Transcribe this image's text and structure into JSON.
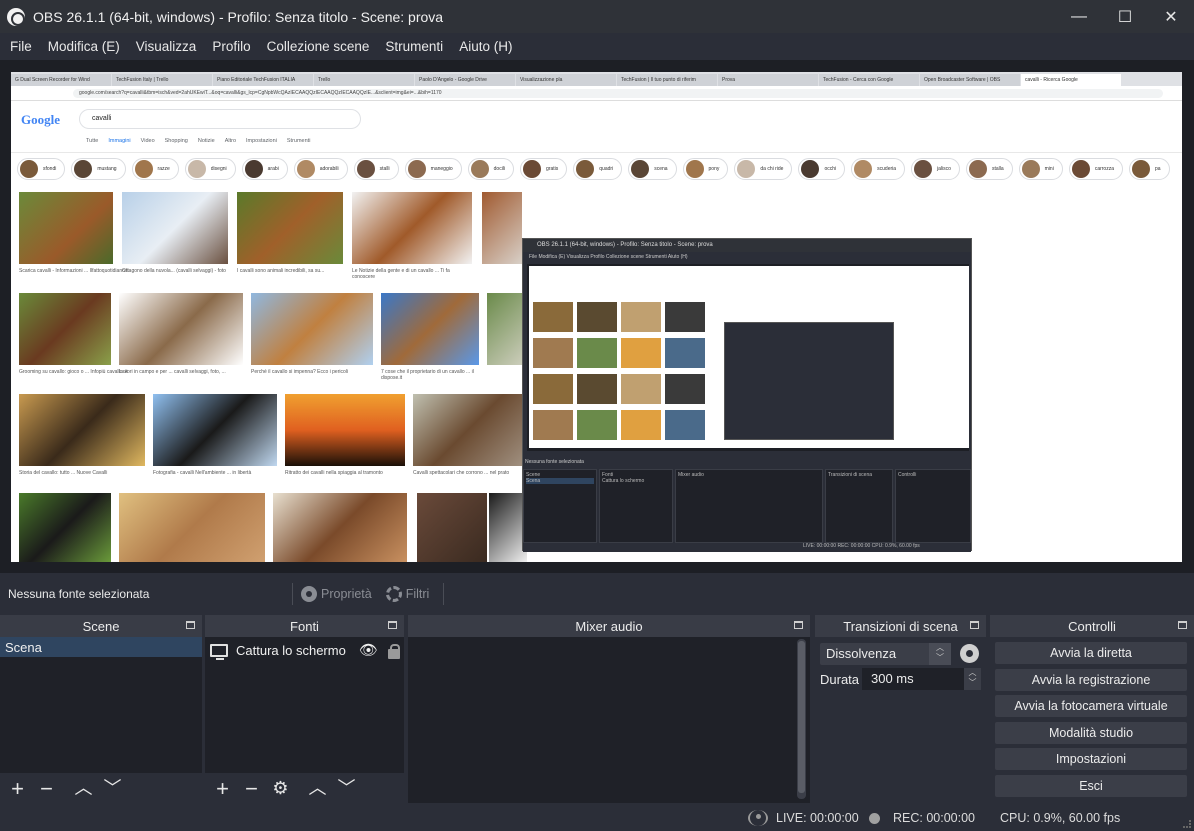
{
  "window": {
    "title": "OBS 26.1.1 (64-bit, windows) - Profilo: Senza titolo - Scene: prova",
    "minimize": "—",
    "maximize": "☐",
    "close": "✕"
  },
  "menu": [
    "File",
    "Modifica (E)",
    "Visualizza",
    "Profilo",
    "Collezione scene",
    "Strumenti",
    "Aiuto (H)"
  ],
  "preview": {
    "browser_tabs": [
      "G Dual Screen Recorder for Wind",
      "TechFusion Italy | Trello",
      "Piano Editoriale TechFusion ITALIA",
      "Trello",
      "Paolo D'Angelo - Google Drive",
      "Visualizzazione pla",
      "TechFusion | Il tuo punto di riferim",
      "Prova",
      "TechFusion - Cerca con Google",
      "Open Broadcaster Software | OBS",
      "cavalli - Ricerca Google"
    ],
    "url": "google.com/search?q=cavalli&tbm=isch&ved=2ahUKEwiT...&oq=cavalli&gs_lcp=CgNpbWcQAzIECAAQQzIECAAQQzIECAAQQzIE...&sclient=img&ei=...&bih=1170",
    "google_logo": "Google",
    "search_query": "cavalli",
    "search_tabs": [
      "Tutte",
      "Immagini",
      "Video",
      "Shopping",
      "Notizie",
      "Altro",
      "Impostazioni",
      "Strumenti"
    ],
    "chips": [
      "sfondi",
      "mustang",
      "razze",
      "disegni",
      "arabi",
      "adorabili",
      "stalli",
      "maneggio",
      "docili",
      "gratis",
      "quadri",
      "scena",
      "pony",
      "da chi ride",
      "occhi",
      "scuderia",
      "jalisco",
      "stalla",
      "mini",
      "carrozza",
      "pa"
    ],
    "captions": [
      "Scarica cavalli - Informazioni ... Ilfattoquotidiano.it",
      "Ottagono della nuvola... (cavalli selvaggi) - foto",
      "I cavalli sono animali incredibili, sa su...",
      "Le Notizie della gente e di un cavallo ... Ti fa conoscere",
      "Grooming su cavallo: gioco o ... Infopiù cavallo .it",
      "Lavori in campo e per ... cavalli selvaggi, foto, ...",
      "Perché il cavallo si impenna? Ecco i pericoli",
      "7 cose che il proprietario di un cavallo ... il dispose.it",
      "Storia del cavallo: tutto ... Nuove Cavalli",
      "Fotografia - cavalli Nell'ambiente ... in libertà",
      "Ritratto dei cavalli nella spiaggia al tramonto",
      "Cavalli spettacolari che corrono ... nel prato"
    ]
  },
  "nested_obs": {
    "title": "OBS 26.1.1 (64-bit, windows) - Profilo: Senza titolo - Scene: prova",
    "menu": "File  Modifica (E)  Visualizza  Profilo  Collezione scene  Strumenti  Aiuto (H)",
    "no_source": "Nessuna fonte selezionata",
    "scene_header": "Scene",
    "sources_header": "Fonti",
    "mixer_header": "Mixer audio",
    "transitions_header": "Transizioni di scena",
    "controls_header": "Controlli",
    "scene_item": "Scena",
    "source_item": "Cattura lo schermo",
    "status": "LIVE: 00:00:00   REC: 00:00:00   CPU: 0.9%, 60.00 fps"
  },
  "source_bar": {
    "no_source": "Nessuna fonte selezionata",
    "properties": "Proprietà",
    "filters": "Filtri"
  },
  "scenes": {
    "header": "Scene",
    "items": [
      "Scena"
    ]
  },
  "sources": {
    "header": "Fonti",
    "items": [
      {
        "name": "Cattura lo schermo",
        "visible_icon": "eye-icon",
        "lock_icon": "lock-icon"
      }
    ]
  },
  "mixer": {
    "header": "Mixer audio"
  },
  "transitions": {
    "header": "Transizioni di scena",
    "selected": "Dissolvenza",
    "duration_label": "Durata",
    "duration_value": "300 ms"
  },
  "controls": {
    "header": "Controlli",
    "buttons": [
      "Avvia la diretta",
      "Avvia la registrazione",
      "Avvia la fotocamera virtuale",
      "Modalità studio",
      "Impostazioni",
      "Esci"
    ]
  },
  "status": {
    "live": "LIVE: 00:00:00",
    "rec": "REC: 00:00:00",
    "cpu": "CPU: 0.9%, 60.00 fps"
  },
  "colors": {
    "background": "#2b2e38",
    "panel": "#1f2128",
    "dock_header": "#393c46",
    "selected_row": "#2f4560",
    "button": "#3b3e48"
  }
}
